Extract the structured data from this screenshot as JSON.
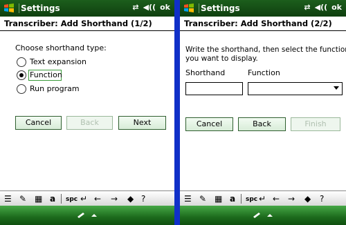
{
  "left": {
    "titlebar": {
      "title": "Settings",
      "ok": "ok"
    },
    "header": {
      "text": "Transcriber: Add Shorthand (1/2)"
    },
    "prompt": "Choose shorthand type:",
    "options": [
      {
        "label": "Text expansion",
        "selected": false
      },
      {
        "label": "Function",
        "selected": true
      },
      {
        "label": "Run program",
        "selected": false
      }
    ],
    "buttons": {
      "cancel": "Cancel",
      "back": "Back",
      "next": "Next"
    },
    "toolbar": {
      "spc": "spc"
    }
  },
  "right": {
    "titlebar": {
      "title": "Settings",
      "ok": "ok"
    },
    "header": {
      "text": "Transcriber: Add Shorthand (2/2)"
    },
    "instructions_line1": "Write the shorthand, then select the function",
    "instructions_line2": "you want to display.",
    "shorthand_label": "Shorthand",
    "function_label": "Function",
    "shorthand_value": "",
    "function_value": "",
    "buttons": {
      "cancel": "Cancel",
      "back": "Back",
      "finish": "Finish"
    },
    "toolbar": {
      "spc": "spc"
    }
  },
  "colors": {
    "titlebar": "#1c5e1c",
    "divider": "#1030c8",
    "focus": "#3a9a3a"
  }
}
